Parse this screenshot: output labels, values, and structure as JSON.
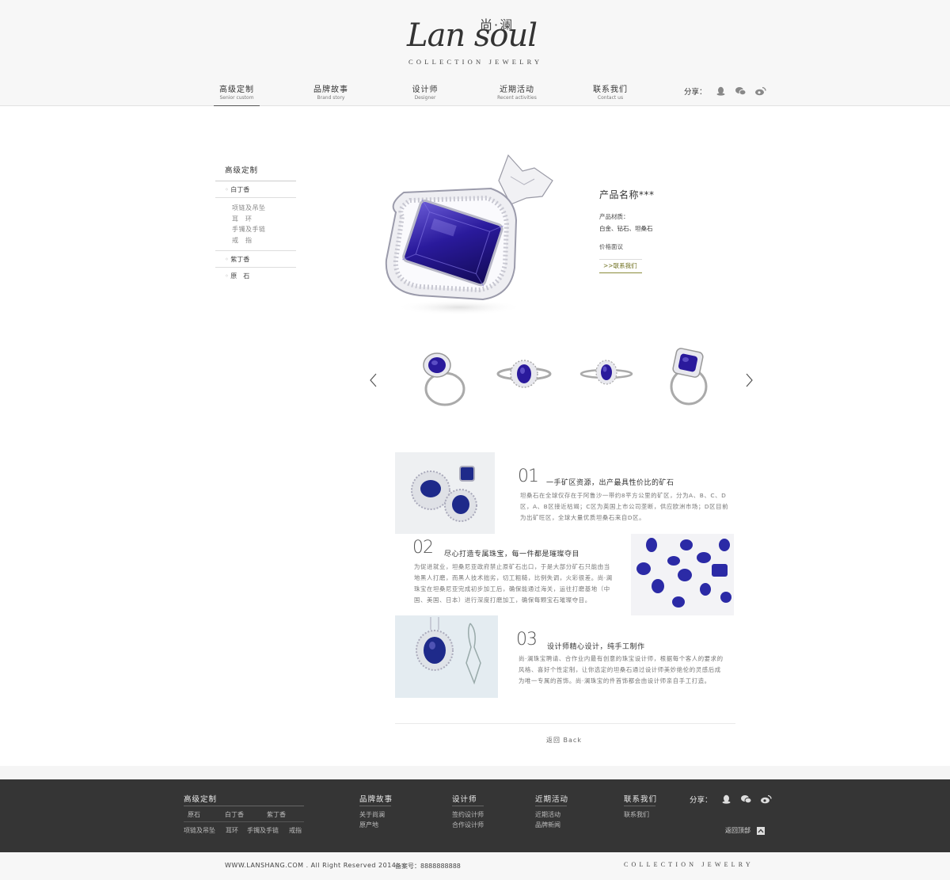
{
  "header": {
    "logo_script": "Lan soul",
    "logo_cn": "尚·澜",
    "logo_sub": "COLLECTION JEWELRY",
    "nav": [
      {
        "cn": "高级定制",
        "en": "Senior custom"
      },
      {
        "cn": "品牌故事",
        "en": "Brand story"
      },
      {
        "cn": "设计师",
        "en": "Designer"
      },
      {
        "cn": "近期活动",
        "en": "Recent activities"
      },
      {
        "cn": "联系我们",
        "en": "Contact us"
      }
    ],
    "share_label": "分享："
  },
  "sidebar": {
    "title": "高级定制",
    "cat1": "白丁香",
    "subs": [
      "项链及吊坠",
      "耳　环",
      "手镯及手链",
      "戒　指"
    ],
    "cat2": "紫丁香",
    "cat3": "原　石"
  },
  "product": {
    "name": "产品名称***",
    "material_label": "产品材质：",
    "material_value": "白金、钻石、坦桑石",
    "price": "价格面议",
    "contact": ">>联系我们"
  },
  "features": [
    {
      "num": "01",
      "title": "一手矿区资源，出产最具性价比的矿石",
      "lines": [
        "坦桑石在全球仅存在于阿鲁沙一带约8平方公里的矿区，分为A、B、C、D",
        "区，A、B区接近枯竭；C区为英国上市公司垄断，供应欧洲市场；D区目前",
        "为出矿旺区，全球大量优质坦桑石来自D区。"
      ]
    },
    {
      "num": "02",
      "title": "尽心打造专属珠宝，每一件都是璀璨夺目",
      "lines": [
        "为促进就业，坦桑尼亚政府禁止原矿石出口，于是大部分矿石只能由当",
        "地黑人打磨，而黑人技术拙劣，切工粗糙，比例失调，火彩很差。尚·澜",
        "珠宝在坦桑尼亚完成初步加工后，确保能通过海关，运往打磨基地（中",
        "国、美国、日本）进行深度打磨加工，确保每颗宝石璀璨夺目。"
      ]
    },
    {
      "num": "03",
      "title": "设计师精心设计，纯手工制作",
      "lines": [
        "尚·澜珠宝聘请、合作业内最有创意的珠宝设计师，根据每个客人的要求的",
        "风格、喜好个性定制，让你选定的坦桑石通过设计师美妙绝伦的灵感后成",
        "为唯一专属的首饰。尚·澜珠宝的件首饰都会由设计师亲自手工打造。"
      ]
    }
  ],
  "back_label": "返回 Back",
  "footer": {
    "col1": {
      "title": "高级定制",
      "row1": [
        "原石",
        "白丁香",
        "紫丁香"
      ],
      "row2": [
        "项链及吊坠",
        "耳环",
        "手镯及手链",
        "戒指"
      ]
    },
    "col2": {
      "title": "品牌故事",
      "links": [
        "关于尚澜",
        "原产地"
      ]
    },
    "col3": {
      "title": "设计师",
      "links": [
        "签约设计师",
        "合作设计师"
      ]
    },
    "col4": {
      "title": "近期活动",
      "links": [
        "近期活动",
        "品牌新闻"
      ]
    },
    "col5": {
      "title": "联系我们",
      "links": [
        "联系我们"
      ]
    },
    "share_label": "分享：",
    "to_top": "返回顶部"
  },
  "bottom": {
    "copyright": "WWW.LANSHANG.COM . All Right Reserved 2014",
    "icp": "备案号：8888888888",
    "brand": "COLLECTION JEWELRY"
  }
}
